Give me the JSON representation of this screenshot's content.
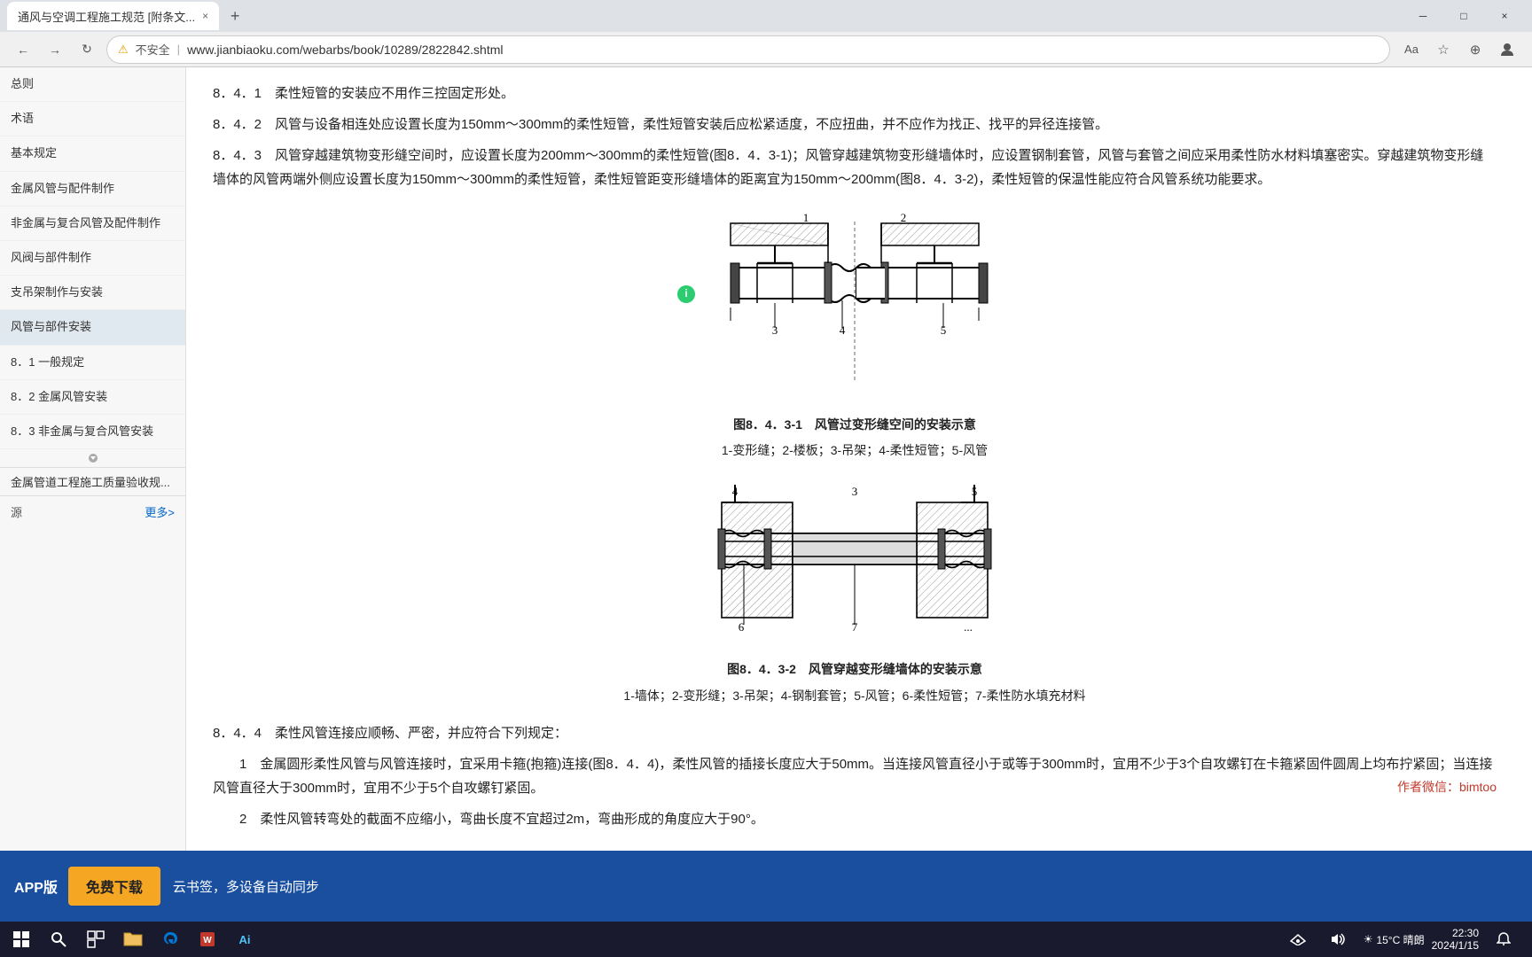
{
  "browser": {
    "tab_title": "通风与空调工程施工规范 [附条文...",
    "tab_close": "×",
    "new_tab": "+",
    "window_minimize": "─",
    "window_maximize": "□",
    "window_close": "×",
    "nav_back": "←",
    "nav_forward": "→",
    "nav_refresh": "↻",
    "security_label": "不安全",
    "url": "www.jianbiaoku.com/webarbs/book/10289/2822842.shtml"
  },
  "toolbar_icons": [
    "Aa",
    "☆",
    "★",
    "⊕"
  ],
  "sidebar": {
    "items": [
      {
        "label": "总则"
      },
      {
        "label": "术语"
      },
      {
        "label": "基本规定"
      },
      {
        "label": "金属风管与配件制作"
      },
      {
        "label": "非金属与复合风管及配件制作"
      },
      {
        "label": "风阀与部件制作"
      },
      {
        "label": "支吊架制作与安装"
      },
      {
        "label": "风管与部件安装"
      },
      {
        "label": "8．1 一般规定"
      },
      {
        "label": "8．2 金属风管安装"
      },
      {
        "label": "8．3 非金属与复合风管安装"
      }
    ],
    "source_label": "源",
    "more_label": "更多>",
    "resource_label": "金属管道工程施工质量验收规..."
  },
  "content": {
    "para1": "8．4．1　柔性短管的安装应不用作三控固定形处。",
    "para2": "8．4．2　风管与设备相连处应设置长度为150mm～300mm的柔性短管，柔性短管安装后应松紧适度，不应扭曲，并不应作为找正、找平的异径连接管。",
    "para3": "8．4．3　风管穿越建筑物变形缝空间时，应设置长度为200mm～300mm的柔性短管(图8．4．3-1)；风管穿越建筑物变形缝墙体时，应设置钢制套管，风管与套管之间应采用柔性防水材料填塞密实。穿越建筑物变形缝墙体的风管两端外侧应设置长度为150mm～300mm的柔性短管，柔性短管距变形缝墙体的距离宜为150mm～200mm(图8．4．3-2)，柔性短管的保温性能应符合风管系统功能要求。",
    "fig1_caption": "图8．4．3-1　风管过变形缝空间的安装示意",
    "fig1_desc": "1-变形缝；2-楼板；3-吊架；4-柔性短管；5-风管",
    "fig2_caption": "图8．4．3-2　风管穿越变形缝墙体的安装示意",
    "fig2_desc": "1-墙体；2-变形缝；3-吊架；4-钢制套管；5-风管；6-柔性短管；7-柔性防水填充材料",
    "para4": "8．4．4　柔性风管连接应顺畅、严密，并应符合下列规定：",
    "para5": "1　金属圆形柔性风管与风管连接时，宜采用卡箍(抱箍)连接(图8．4．4)，柔性风管的插接长度应大于50mm。当连接风管直径小于或等于300mm时，宜用不少于3个自攻螺钉在卡箍紧固件圆周上均布拧紧固；当连接风管直径大于300mm时，宜用不少于5个自攻螺钉紧固。",
    "para6": "2　柔性风管转弯处的截面不应缩小，弯曲长度不宜超过2m，弯曲形成的角度应大于90°。",
    "author_note": "作者微信：bimtoo"
  },
  "app_bar": {
    "version_label": "APP版",
    "download_label": "免费下载",
    "description": "云书签，多设备自动同步"
  },
  "taskbar": {
    "weather": "15°C 晴朗",
    "ai_label": "Ai"
  }
}
